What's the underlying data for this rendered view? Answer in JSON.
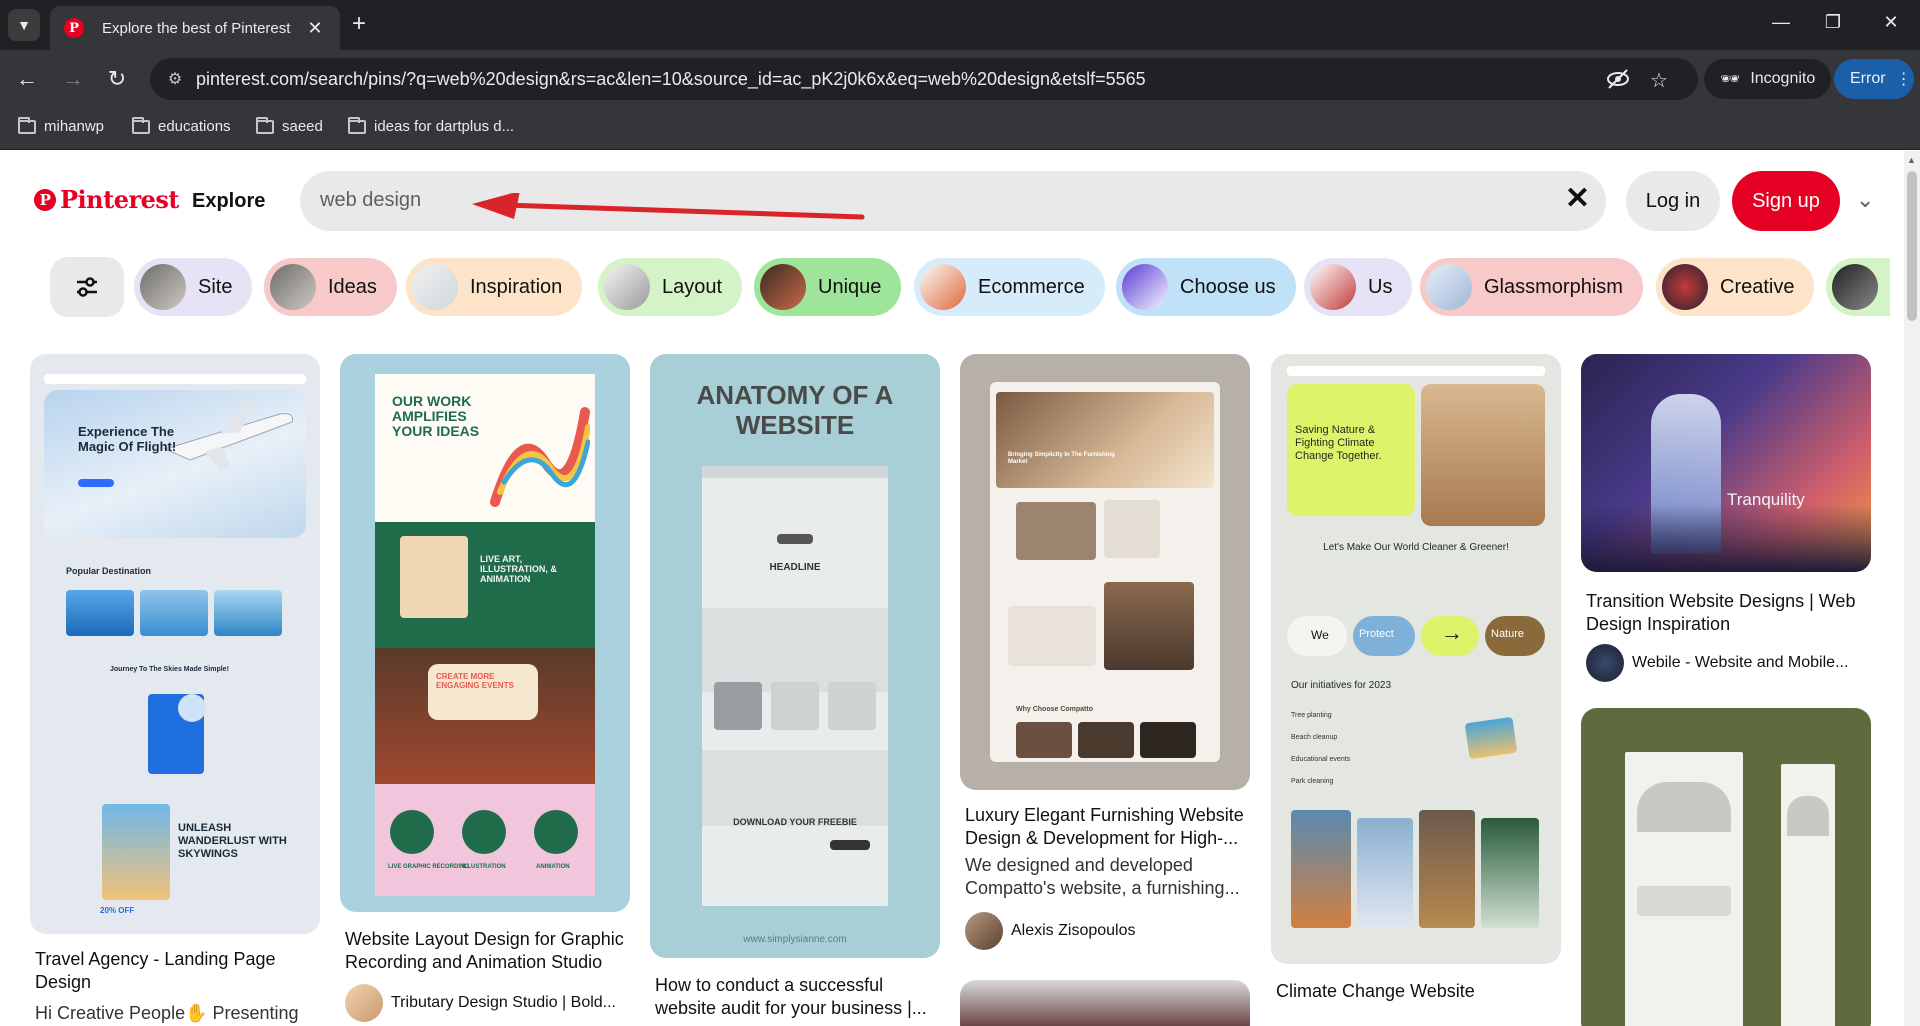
{
  "browser": {
    "tab_title": "Explore the best of Pinterest",
    "url": "pinterest.com/search/pins/?q=web%20design&rs=ac&len=10&source_id=ac_pK2j0k6x&eq=web%20design&etslf=5565",
    "incognito_label": "Incognito",
    "error_label": "Error",
    "bookmarks": [
      "mihanwp",
      "educations",
      "saeed",
      "ideas for dartplus d..."
    ]
  },
  "header": {
    "logo_text": "Pinterest",
    "explore_label": "Explore",
    "search_value": "web design",
    "login_label": "Log in",
    "signup_label": "Sign up"
  },
  "chips": [
    {
      "label": "Site",
      "bg": "#e6e3f7"
    },
    {
      "label": "Ideas",
      "bg": "#f8c9c9"
    },
    {
      "label": "Inspiration",
      "bg": "#fde3c8"
    },
    {
      "label": "Layout",
      "bg": "#d4f3c6"
    },
    {
      "label": "Unique",
      "bg": "#9ee49b"
    },
    {
      "label": "Ecommerce",
      "bg": "#d7ecfb"
    },
    {
      "label": "Choose us",
      "bg": "#bfe2f8"
    },
    {
      "label": "Us",
      "bg": "#e6e3f7"
    },
    {
      "label": "Glassmorphism",
      "bg": "#f8c9c9"
    },
    {
      "label": "Creative",
      "bg": "#fde3c8"
    }
  ],
  "pins": {
    "p1": {
      "title": "Travel Agency - Landing Page Design",
      "desc": "Hi Creative People✋ Presenting",
      "mock": {
        "hero": "Experience The Magic Of Flight!",
        "section": "Popular Destination",
        "mid": "Journey To The Skies Made Simple!",
        "bottom": "UNLEASH WANDERLUST WITH SKYWINGS",
        "off": "20% OFF"
      }
    },
    "p2": {
      "title": "Website Layout Design for Graphic Recording and Animation Studio",
      "author": "Tributary Design Studio | Bold...",
      "mock": {
        "hero": "OUR WORK AMPLIFIES YOUR IDEAS",
        "mid": "LIVE ART, ILLUSTRATION, & ANIMATION",
        "events": "CREATE MORE ENGAGING EVENTS",
        "l1": "LIVE GRAPHIC RECORDING",
        "l2": "ILLUSTRATION",
        "l3": "ANIMATION"
      }
    },
    "p3": {
      "title": "How to conduct a successful website audit for your business |...",
      "mock": {
        "heading": "ANATOMY OF A WEBSITE",
        "headline": "HEADLINE",
        "freebie": "DOWNLOAD YOUR FREEBIE",
        "footer": "www.simplysianne.com"
      }
    },
    "p4": {
      "title": "Luxury Elegant Furnishing Website Design & Development for High-...",
      "desc": "We designed and developed Compatto's website, a furnishing...",
      "author": "Alexis Zisopoulos",
      "mock": {
        "hero": "Bringing Simplicity In The Furnishing Market",
        "why": "Why Choose Compatto"
      }
    },
    "p5": {
      "title": "Climate Change Website",
      "mock": {
        "hero": "Saving Nature & Fighting Climate Change Together.",
        "mid": "Let's Make Our World Cleaner & Greener!",
        "we": "We",
        "protect": "Protect",
        "nature": "Nature",
        "init": "Our initiatives for 2023",
        "rows": [
          "Tree planting",
          "Beach cleanup",
          "Educational events",
          "Park cleaning"
        ]
      }
    },
    "p6": {
      "title": "Transition Website Designs | Web Design Inspiration",
      "author": "Webile - Website and Mobile...",
      "mock": {
        "word": "Tranquility"
      }
    }
  },
  "colors": {
    "brand": "#e60023",
    "chrome_dark": "#202124",
    "chrome": "#35363a"
  }
}
